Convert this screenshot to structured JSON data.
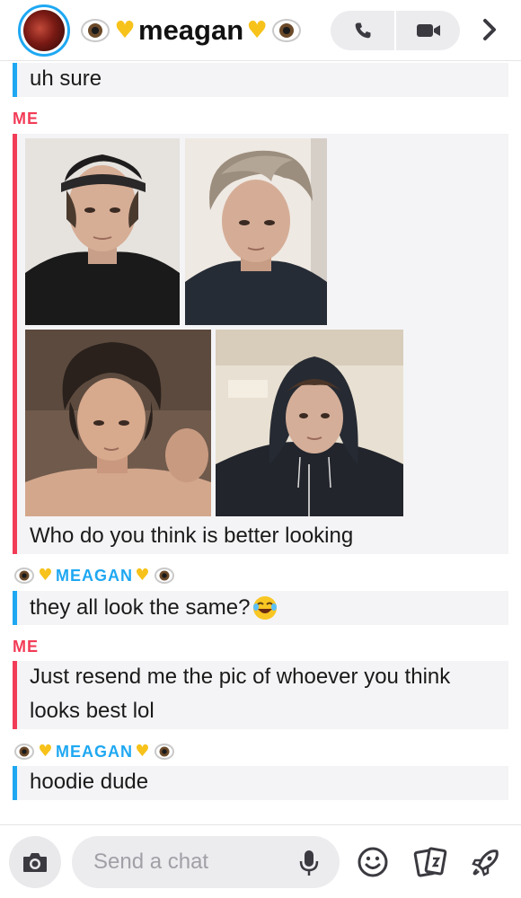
{
  "header": {
    "contact_name": "meagan",
    "avatar_icon": "profile-avatar",
    "call_icon": "phone-icon",
    "video_icon": "video-camera-icon",
    "forward_icon": "chevron-right-icon"
  },
  "colors": {
    "me": "#f23c57",
    "friend": "#1fa8f2",
    "bubble": "#f4f4f6",
    "heart": "#f7c21a"
  },
  "messages": [
    {
      "sender": "",
      "text": "uh sure"
    },
    {
      "sender": "ME",
      "text": "Who do you think is better looking",
      "photos": 4
    },
    {
      "sender": "MEAGAN",
      "text": "they all look the same?"
    },
    {
      "sender": "ME",
      "lines": [
        "Just resend me the pic of whoever you think",
        "looks best lol"
      ]
    },
    {
      "sender": "MEAGAN",
      "text": "hoodie dude"
    }
  ],
  "composer": {
    "placeholder": "Send a chat",
    "camera_icon": "camera-icon",
    "mic_icon": "microphone-icon",
    "emoji_icon": "smiley-icon",
    "cards_icon": "cards-icon",
    "rocket_icon": "rocket-icon"
  }
}
